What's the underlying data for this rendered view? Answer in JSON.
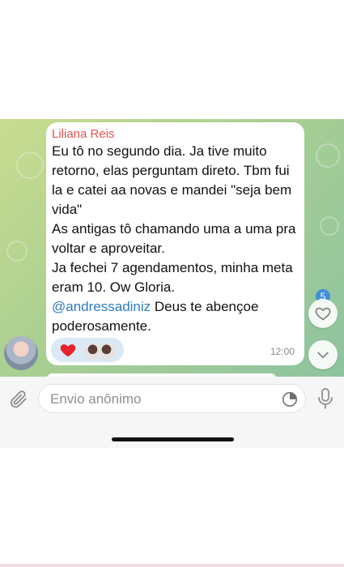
{
  "message": {
    "sender": "Liliana Reis",
    "paragraphs": [
      "Eu tô no segundo dia. Ja tive muito retorno, elas perguntam direto. Tbm fui la e catei aa novas e mandei \"seja bem vida\"",
      "As antigas tô chamando uma a uma pra voltar e aproveitar.",
      "Ja fechei 7 agendamentos, minha meta eram 10. Ow Gloria."
    ],
    "mention": "@andressadiniz",
    "mention_text": " Deus te abençoe poderosamente.",
    "time": "12:00",
    "reactions": {
      "emoji": "heart",
      "reactor_count_shown": 2
    }
  },
  "side": {
    "badge": "5"
  },
  "composer": {
    "placeholder": "Envio anônimo"
  },
  "colors": {
    "sender": "#e0524f",
    "mention": "#2e7bc4",
    "badge": "#3f8fdc",
    "chat_bg": "#a9cf92"
  },
  "icons": [
    "heart-icon",
    "chevron-down-icon",
    "paperclip-icon",
    "sticker-icon",
    "microphone-icon"
  ]
}
